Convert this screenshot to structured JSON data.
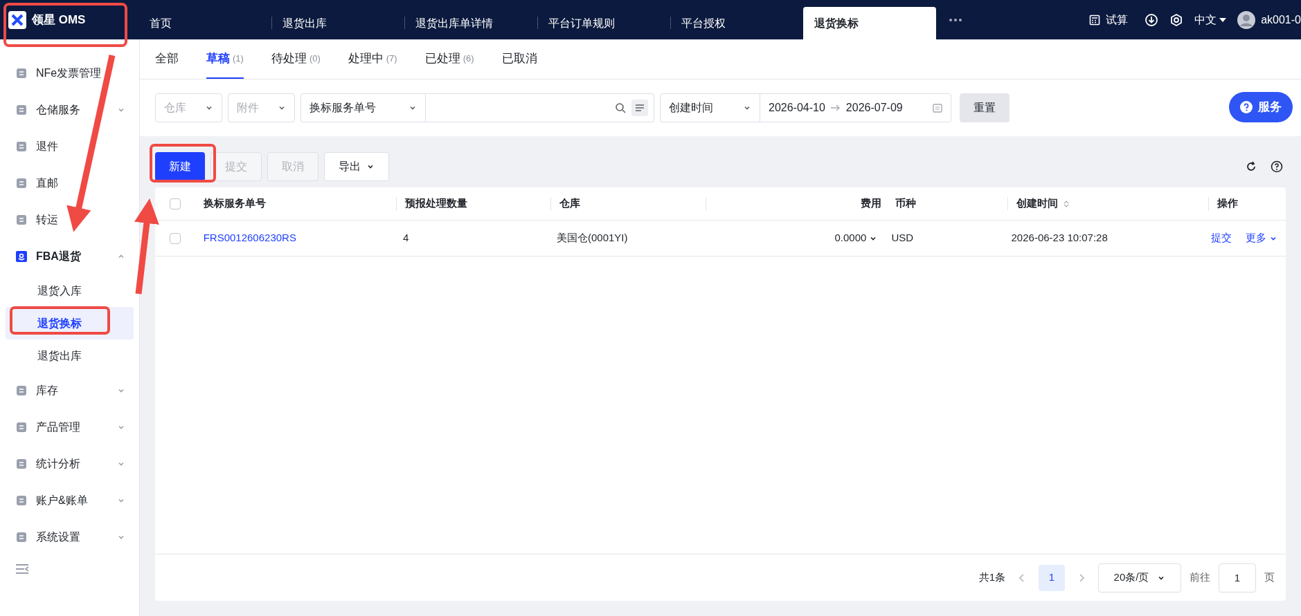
{
  "topbar": {
    "logo_text": "领星 OMS",
    "tabs": [
      {
        "label": "首页",
        "selected": false
      },
      {
        "label": "退货出库",
        "selected": false
      },
      {
        "label": "退货出库单详情",
        "selected": false
      },
      {
        "label": "平台订单规则",
        "selected": false
      },
      {
        "label": "平台授权",
        "selected": false
      },
      {
        "label": "退货换标",
        "selected": true
      }
    ],
    "calc": "试算",
    "language": "中文",
    "user": "ak001-0"
  },
  "sidebar": {
    "items": [
      {
        "label": "NFe发票管理"
      },
      {
        "label": "仓储服务",
        "expanded": false
      },
      {
        "label": "退件"
      },
      {
        "label": "直邮"
      },
      {
        "label": "转运"
      },
      {
        "label": "FBA退货",
        "expanded": true,
        "children": [
          {
            "label": "退货入库",
            "selected": false
          },
          {
            "label": "退货换标",
            "selected": true
          },
          {
            "label": "退货出库",
            "selected": false
          }
        ]
      },
      {
        "label": "库存",
        "expanded": false
      },
      {
        "label": "产品管理",
        "expanded": false
      },
      {
        "label": "统计分析",
        "expanded": false
      },
      {
        "label": "账户&账单",
        "expanded": false
      },
      {
        "label": "系统设置",
        "expanded": false
      }
    ]
  },
  "status_tabs": [
    {
      "label": "全部",
      "selected": false
    },
    {
      "label": "草稿",
      "count": "(1)",
      "selected": true
    },
    {
      "label": "待处理",
      "count": "(0)",
      "selected": false
    },
    {
      "label": "处理中",
      "count": "(7)",
      "selected": false
    },
    {
      "label": "已处理",
      "count": "(6)",
      "selected": false
    },
    {
      "label": "已取消",
      "selected": false
    }
  ],
  "filters": {
    "warehouse": {
      "placeholder": "仓库"
    },
    "attachment": {
      "placeholder": "附件"
    },
    "search_type": "换标服务单号",
    "date_type": "创建时间",
    "date_start": "2026-04-10",
    "date_end": "2026-07-09",
    "reset": "重置"
  },
  "service_button": "服务",
  "toolbar": [
    {
      "label": "新建",
      "kind": "primary",
      "disabled": false
    },
    {
      "label": "提交",
      "kind": "default",
      "disabled": true
    },
    {
      "label": "取消",
      "kind": "default",
      "disabled": true
    },
    {
      "label": "导出",
      "kind": "dropdown",
      "disabled": false
    }
  ],
  "table": {
    "all_checked": false,
    "columns": [
      "换标服务单号",
      "预报处理数量",
      "仓库",
      "费用",
      "币种",
      "创建时间",
      "操作"
    ],
    "rows": [
      {
        "checked": false,
        "order_no": "FRS0012606230RS",
        "quantity": "4",
        "warehouse": "美国仓(0001YI)",
        "fee": "0.0000",
        "currency": "USD",
        "created": "2026-06-23 10:07:28",
        "actions": [
          "提交",
          "更多"
        ]
      }
    ]
  },
  "pagination": {
    "total": "共1条",
    "pages": [
      {
        "label": "1",
        "selected": true
      }
    ],
    "page_size": "20条/页",
    "goto_label": "前往",
    "goto_value": "1",
    "goto_suffix": "页"
  }
}
